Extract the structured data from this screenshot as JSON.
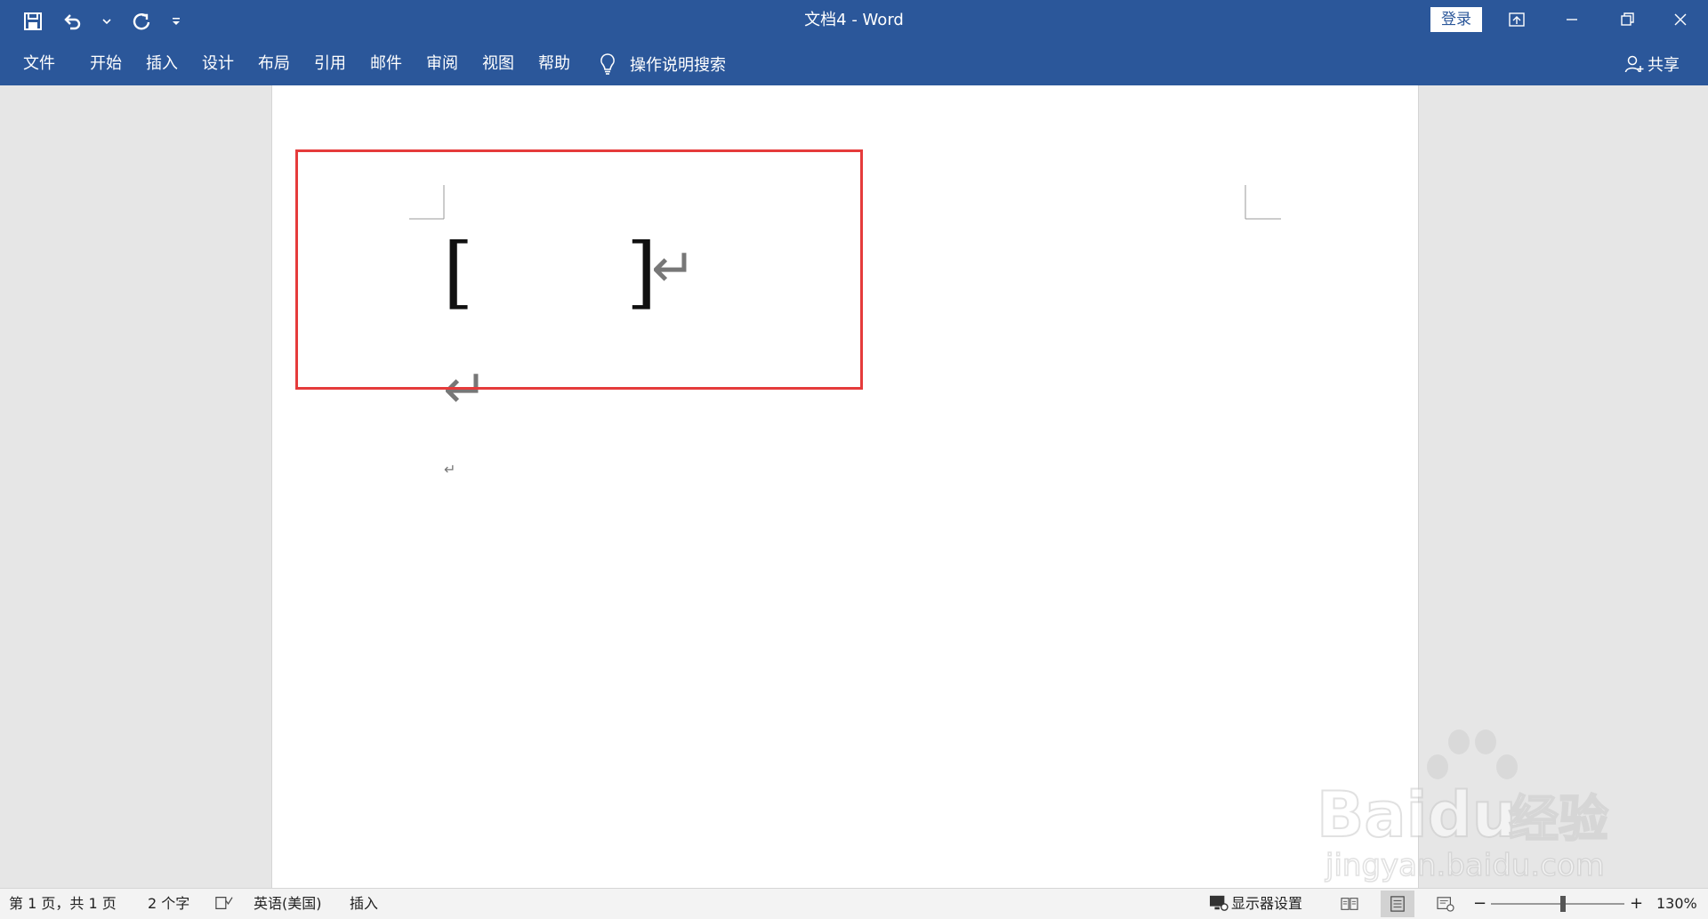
{
  "window": {
    "title": "文档4  -  Word",
    "login_label": "登录"
  },
  "qat": {
    "save_icon": "save-icon",
    "undo_icon": "undo-icon",
    "redo_icon": "redo-icon",
    "customize_icon": "customize-qat-icon"
  },
  "ribbon": {
    "tabs": [
      "文件",
      "开始",
      "插入",
      "设计",
      "布局",
      "引用",
      "邮件",
      "审阅",
      "视图",
      "帮助"
    ],
    "tell_me": "操作说明搜索",
    "share": "共享"
  },
  "document": {
    "bracket_open": "[",
    "bracket_close": "]",
    "paragraph_mark": "↵"
  },
  "watermark": {
    "brand": "Baidu",
    "brand_cn": "经验",
    "url": "jingyan.baidu.com"
  },
  "status": {
    "page": "第 1 页，共 1 页",
    "words": "2 个字",
    "language": "英语(美国)",
    "mode": "插入",
    "display_settings": "显示器设置",
    "zoom": "130%"
  },
  "colors": {
    "ribbon": "#2b579a",
    "highlight": "#e53b3b"
  }
}
